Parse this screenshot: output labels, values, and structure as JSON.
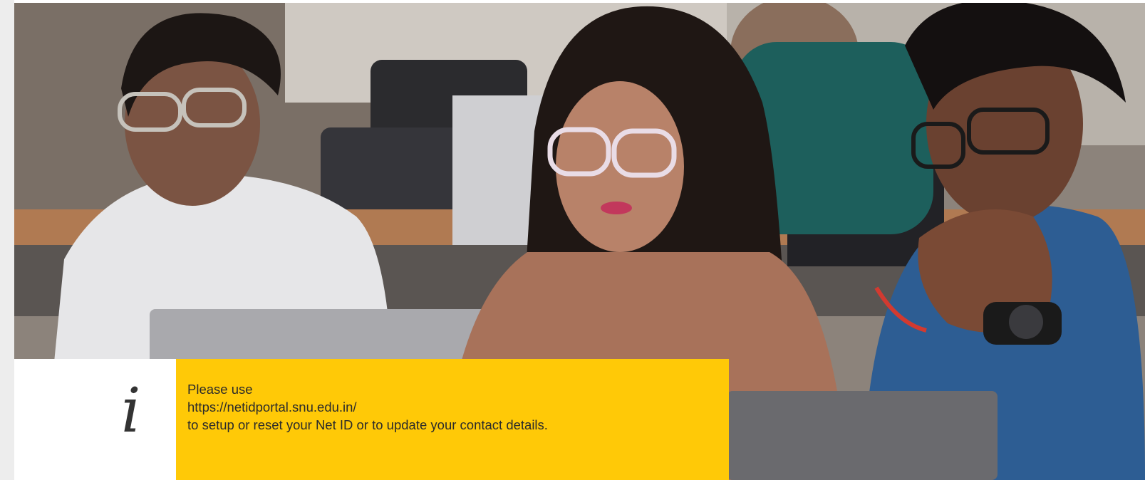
{
  "notice": {
    "icon": "info-icon",
    "icon_glyph": "i",
    "line1": "Please use",
    "link_text": "https://netidportal.snu.edu.in/",
    "line3": "to setup or reset your Net ID or to update your contact details."
  },
  "colors": {
    "notice_background": "#ffc907",
    "icon_background": "#ffffff",
    "page_background": "#f2f2f2"
  },
  "hero": {
    "image": "students-in-classroom-photo"
  }
}
